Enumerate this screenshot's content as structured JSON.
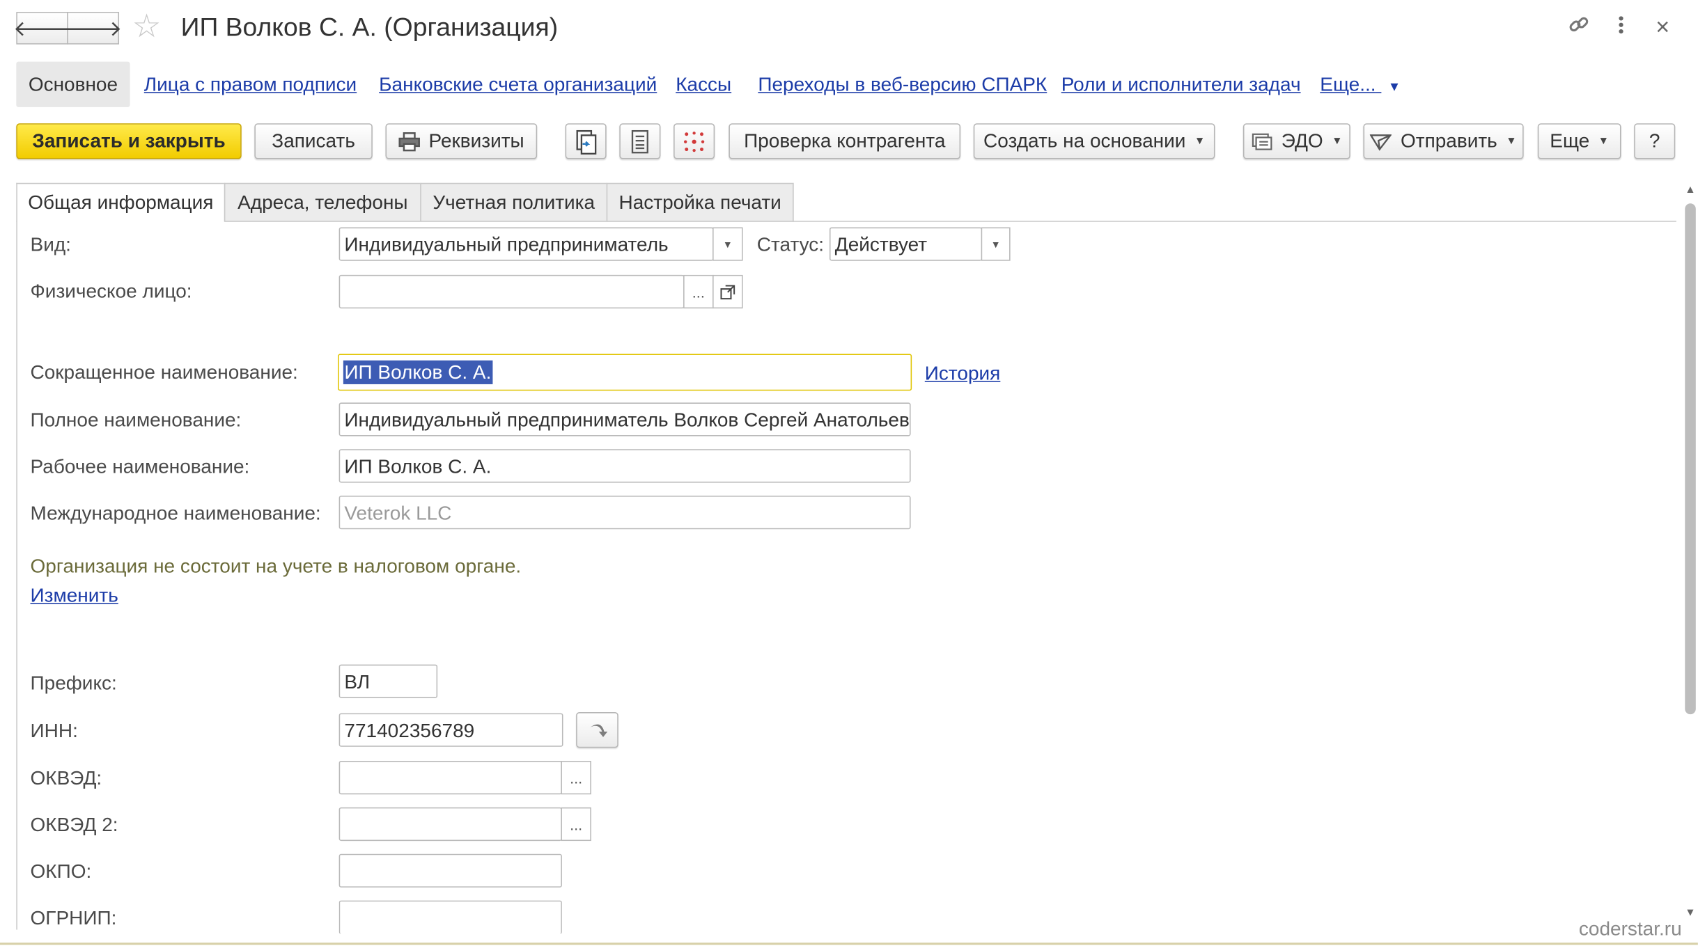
{
  "window": {
    "title": "ИП Волков С. А. (Организация)",
    "back_glyph": "🡐",
    "forward_glyph": "🡒",
    "favorite_icon": "star-icon",
    "link_icon": "link-icon",
    "more_icon": "more-vertical-icon",
    "close_glyph": "×"
  },
  "sections": {
    "active": "Основное",
    "links": [
      "Лица с правом подписи",
      "Банковские счета организаций",
      "Кассы",
      "Переходы в веб-версию СПАРК",
      "Роли и исполнители задач",
      "Еще..."
    ]
  },
  "toolbar": {
    "save_close": "Записать и закрыть",
    "save": "Записать",
    "requisites": "Реквизиты",
    "check_counterparty": "Проверка контрагента",
    "create_based_on": "Создать на основании",
    "edo": "ЭДО",
    "send": "Отправить",
    "more": "Еще",
    "help": "?"
  },
  "tabs": [
    "Общая информация",
    "Адреса, телефоны",
    "Учетная политика",
    "Настройка печати"
  ],
  "form": {
    "vid_label": "Вид:",
    "vid_value": "Индивидуальный предприниматель",
    "status_label": "Статус:",
    "status_value": "Действует",
    "person_label": "Физическое лицо:",
    "person_value": "",
    "short_name_label": "Сокращенное наименование:",
    "short_name_value": "ИП Волков С. А.",
    "history_link": "История",
    "full_name_label": "Полное наименование:",
    "full_name_value": "Индивидуальный предприниматель Волков Сергей Анатольевич",
    "work_name_label": "Рабочее наименование:",
    "work_name_value": "ИП Волков С. А.",
    "intl_name_label": "Международное наименование:",
    "intl_name_placeholder": "Veterok LLC",
    "tax_info": "Организация не состоит на учете в налоговом органе.",
    "change_link": "Изменить",
    "prefix_label": "Префикс:",
    "prefix_value": "ВЛ",
    "inn_label": "ИНН:",
    "inn_value": "771402356789",
    "okved_label": "ОКВЭД:",
    "okved_value": "",
    "okved2_label": "ОКВЭД 2:",
    "okved2_value": "",
    "okpo_label": "ОКПО:",
    "okpo_value": "",
    "ogrnip_label": "ОГРНИП:",
    "ogrnip_value": ""
  },
  "watermark": "coderstar.ru",
  "colors": {
    "accent_yellow": "#f5d300",
    "link_blue": "#1c3ca8",
    "selection": "#3d5cb4",
    "info_text": "#6b6b3a"
  }
}
